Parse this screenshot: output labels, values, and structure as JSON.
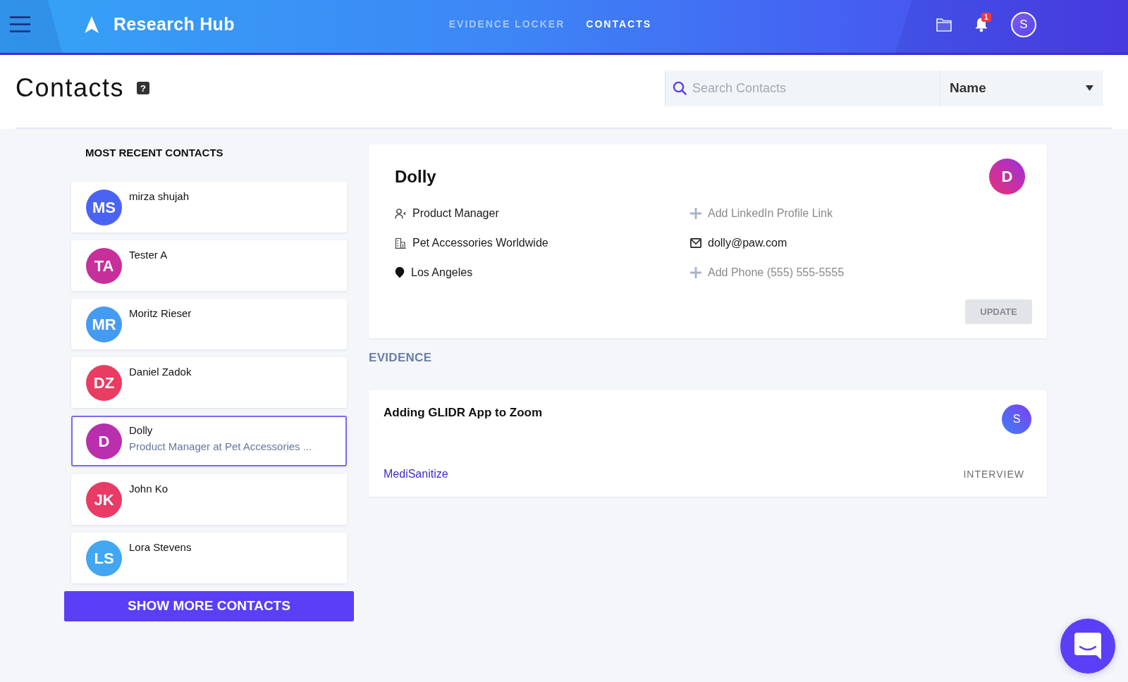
{
  "header": {
    "app_name": "Research Hub",
    "nav": [
      {
        "label": "EVIDENCE LOCKER",
        "selected": false
      },
      {
        "label": "CONTACTS",
        "selected": true
      }
    ],
    "notification_count": "1",
    "user_initials": "S"
  },
  "page": {
    "title": "Contacts",
    "help_glyph": "?",
    "search": {
      "placeholder": "Search Contacts"
    },
    "sort_dropdown": {
      "value": "Name"
    }
  },
  "recent_contacts": {
    "heading": "MOST RECENT CONTACTS",
    "contacts": [
      {
        "initials": "MS",
        "name": "mirza shujah",
        "color": "#4a63f2",
        "selected": false
      },
      {
        "initials": "TA",
        "name": "Tester A",
        "color": "#c72f9a",
        "selected": false
      },
      {
        "initials": "MR",
        "name": "Moritz Rieser",
        "color": "#459bf2",
        "selected": false
      },
      {
        "initials": "DZ",
        "name": "Daniel Zadok",
        "color": "#e93c62",
        "selected": false
      },
      {
        "initials": "D",
        "name": "Dolly",
        "subtitle": "Product Manager at Pet Accessories ...",
        "color": "#b92fae",
        "selected": true
      },
      {
        "initials": "JK",
        "name": "John Ko",
        "color": "#e83b66",
        "selected": false
      },
      {
        "initials": "LS",
        "name": "Lora Stevens",
        "color": "#42a6f1",
        "selected": false
      }
    ],
    "show_more_button": "SHOW MORE CONTACTS"
  },
  "contact_detail": {
    "name": "Dolly",
    "initials": "D",
    "fields": [
      {
        "kind": "role",
        "value": "Product Manager"
      },
      {
        "kind": "linkedin",
        "placeholder": "Add LinkedIn Profile Link"
      },
      {
        "kind": "company",
        "value": "Pet Accessories Worldwide"
      },
      {
        "kind": "email",
        "value": "dolly@paw.com"
      },
      {
        "kind": "location",
        "value": "Los Angeles"
      },
      {
        "kind": "phone",
        "placeholder": "Add Phone (555) 555-5555"
      }
    ],
    "update_button": {
      "label": "UPDATE",
      "disabled": true
    }
  },
  "evidence": {
    "heading": "EVIDENCE",
    "items": [
      {
        "title": "Adding GLIDR App to Zoom",
        "owner_initials": "S",
        "project": "MediSanitize",
        "type": "INTERVIEW"
      }
    ]
  }
}
